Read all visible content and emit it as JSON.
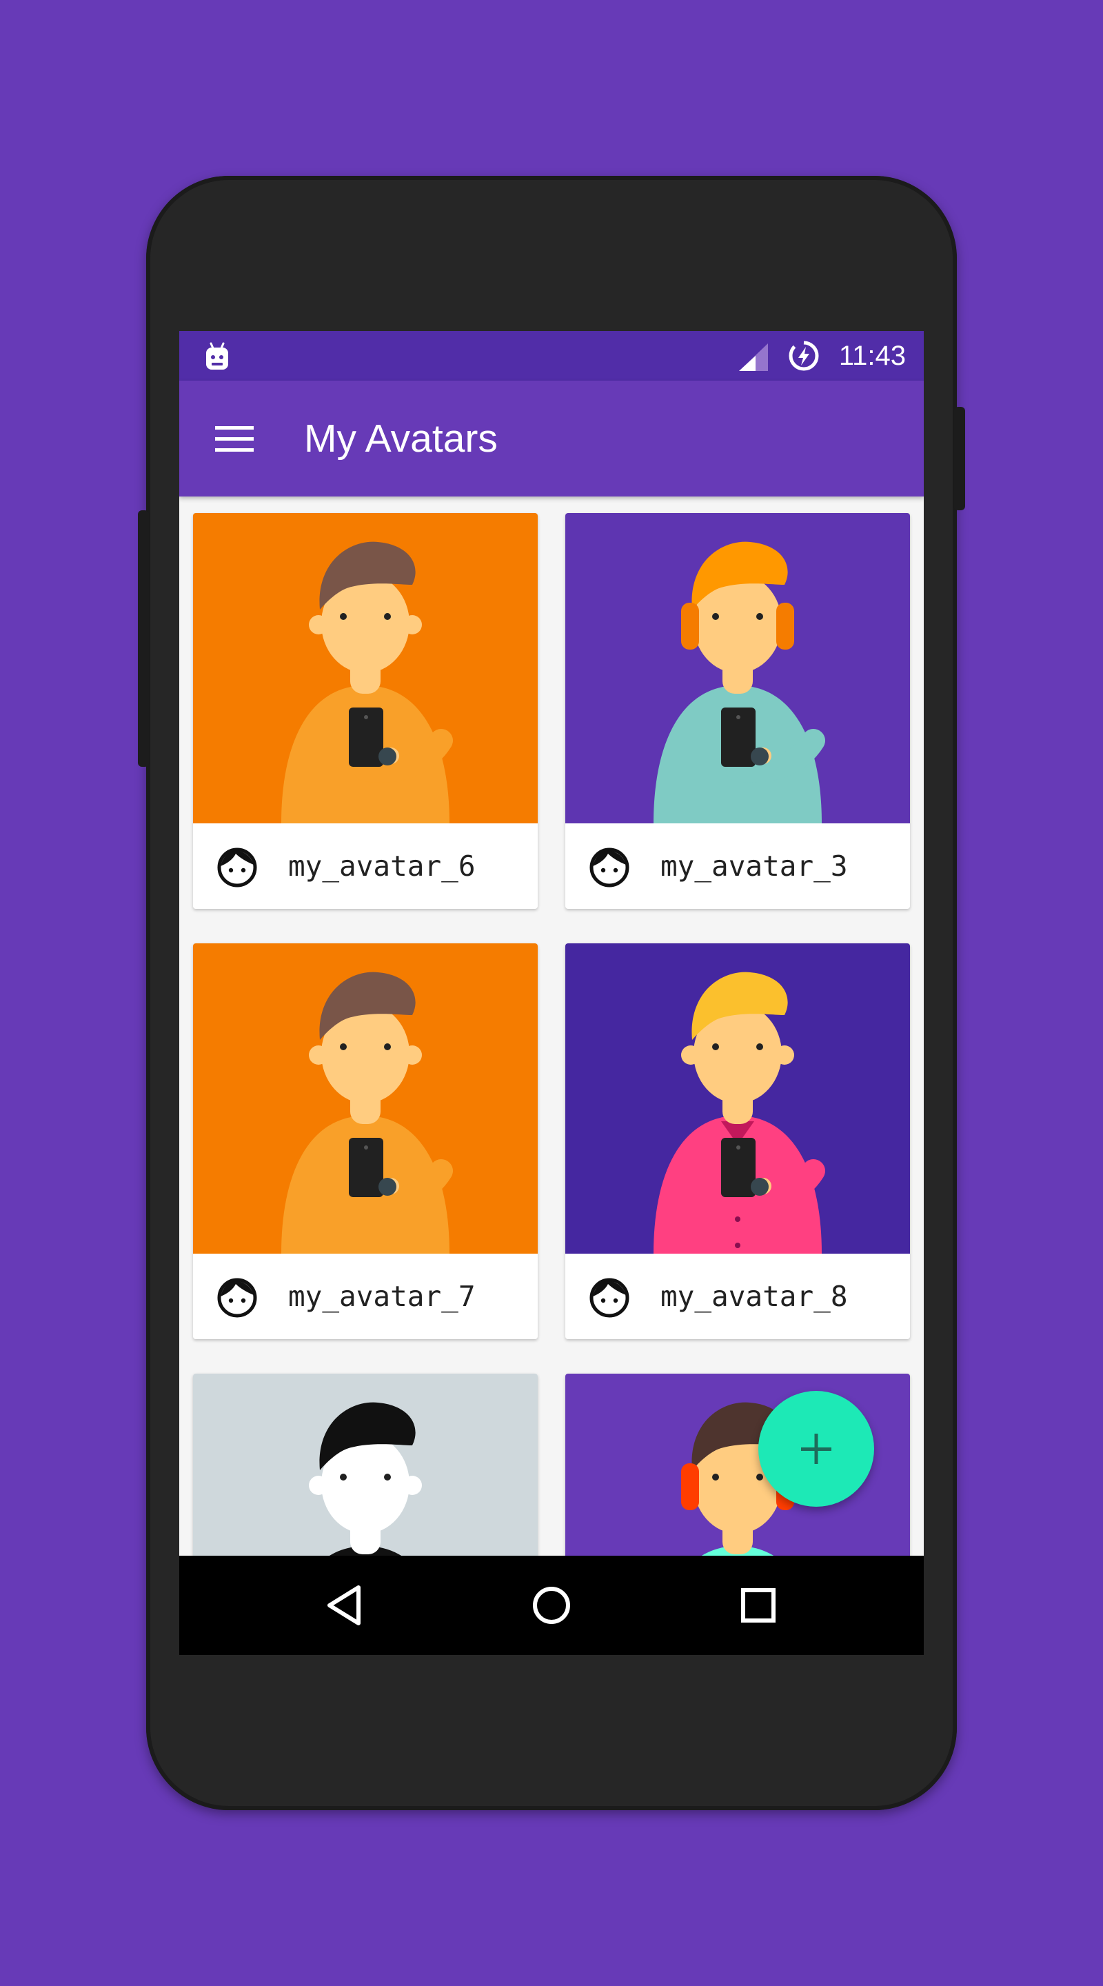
{
  "app": {
    "title": "My Avatars",
    "accent_color": "#1DE9B6",
    "primary_color": "#673AB7",
    "primary_dark_color": "#512DA8"
  },
  "statusbar": {
    "time": "11:43",
    "icons": [
      "android-notification-icon",
      "signal-icon",
      "battery-charging-icon"
    ]
  },
  "toolbar": {
    "menu_icon": "hamburger-menu-icon",
    "title": "My Avatars"
  },
  "avatars": [
    {
      "name": "my_avatar_6",
      "background": "#F57C00",
      "hair": "#795548",
      "shirt": "#F9A029",
      "icon": "face-icon"
    },
    {
      "name": "my_avatar_3",
      "background": "#5E35B1",
      "hair": "#FF9800",
      "shirt": "#7FCBC4",
      "icon": "face-icon"
    },
    {
      "name": "my_avatar_7",
      "background": "#F57C00",
      "hair": "#795548",
      "shirt": "#F9A029",
      "icon": "face-icon"
    },
    {
      "name": "my_avatar_8",
      "background": "#4527A0",
      "hair": "#FBC02D",
      "shirt": "#FF4081",
      "icon": "face-icon"
    },
    {
      "name": "",
      "background": "#CFD8DC",
      "hair": "#111111",
      "shirt": "#111111",
      "icon": "face-icon"
    },
    {
      "name": "",
      "background": "#673AB7",
      "hair": "#4E342E",
      "shirt": "#64FFDA",
      "icon": "face-icon"
    }
  ],
  "fab": {
    "icon": "plus-icon"
  },
  "navbar": {
    "icons": [
      "back-icon",
      "home-icon",
      "recents-icon"
    ]
  }
}
